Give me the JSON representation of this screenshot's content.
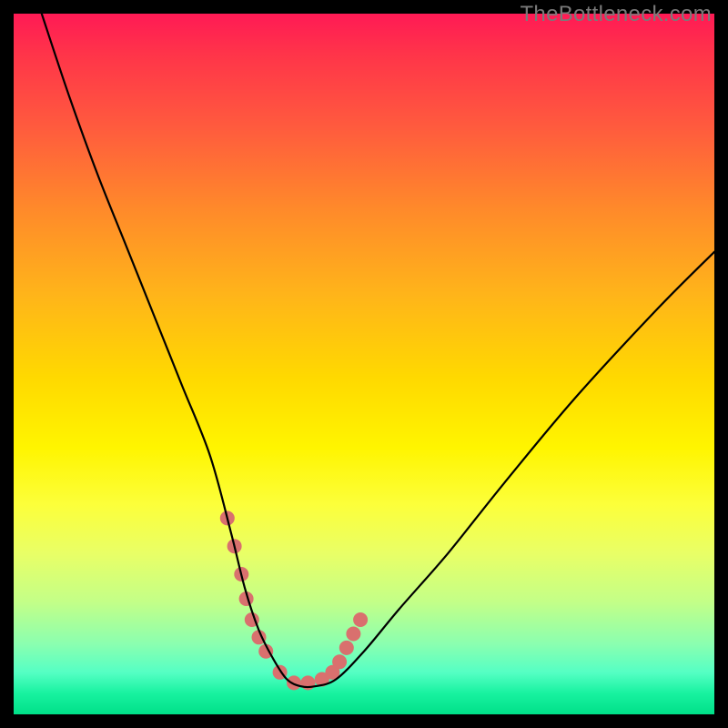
{
  "watermark": "TheBottleneck.com",
  "chart_data": {
    "type": "line",
    "title": "",
    "xlabel": "",
    "ylabel": "",
    "xlim": [
      0,
      100
    ],
    "ylim": [
      0,
      100
    ],
    "series": [
      {
        "name": "bottleneck-curve",
        "x": [
          4,
          8,
          12,
          16,
          20,
          24,
          28,
          31,
          33,
          35,
          37,
          39,
          41,
          43,
          46,
          50,
          55,
          62,
          70,
          80,
          92,
          100
        ],
        "values": [
          100,
          88,
          77,
          67,
          57,
          47,
          37,
          26,
          18,
          12,
          8,
          5,
          4,
          4,
          5,
          9,
          15,
          23,
          33,
          45,
          58,
          66
        ]
      }
    ],
    "highlight": {
      "name": "optimal-band",
      "dots_x": [
        30.5,
        31.5,
        32.5,
        33.2,
        34.0,
        35.0,
        36.0,
        38.0,
        40.0,
        42.0,
        44.0,
        45.5,
        46.5,
        47.5,
        48.5,
        49.5
      ],
      "dots_value": [
        28.0,
        24.0,
        20.0,
        16.5,
        13.5,
        11.0,
        9.0,
        6.0,
        4.5,
        4.5,
        5.0,
        6.0,
        7.5,
        9.5,
        11.5,
        13.5
      ],
      "color": "#d9706e"
    },
    "curve_color": "#000000",
    "background": "rainbow-vertical"
  }
}
